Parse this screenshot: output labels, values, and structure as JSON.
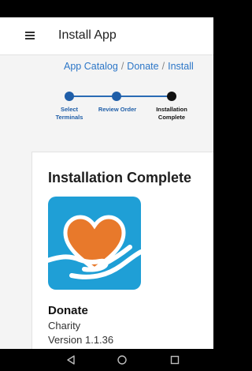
{
  "app_bar": {
    "title": "Install App",
    "menu_icon": "hamburger-menu-icon"
  },
  "breadcrumb": {
    "items": [
      "App Catalog",
      "Donate",
      "Install"
    ],
    "separator": "/"
  },
  "stepper": {
    "steps": [
      {
        "label_line1": "Select",
        "label_line2": "Terminals"
      },
      {
        "label_line1": "Review Order",
        "label_line2": ""
      },
      {
        "label_line1": "Installation",
        "label_line2": "Complete"
      }
    ],
    "current_step_index": 2
  },
  "card": {
    "title": "Installation Complete",
    "app_icon": "heart-in-hand-icon",
    "app_name": "Donate",
    "app_category": "Charity",
    "app_version": "Version 1.1.36"
  },
  "nav_bar": {
    "back_icon": "back-triangle-icon",
    "home_icon": "home-circle-icon",
    "recents_icon": "recents-square-icon"
  },
  "colors": {
    "accent": "#1f5ea8",
    "link": "#2c76c7",
    "icon_background": "#1f9fd6",
    "heart": "#e8792b"
  }
}
